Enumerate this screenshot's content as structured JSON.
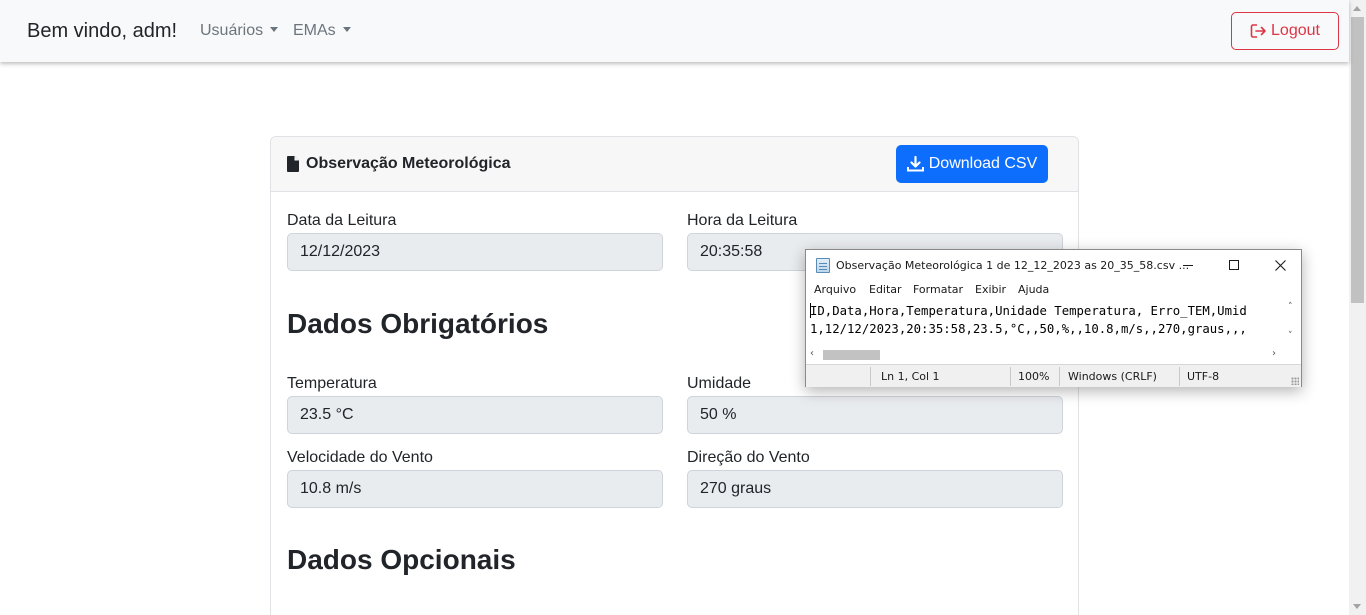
{
  "navbar": {
    "brand": "Bem vindo, adm!",
    "menu_users": "Usuários",
    "menu_emas": "EMAs",
    "logout_label": "Logout",
    "logout_color": "#dc3545"
  },
  "card": {
    "title": "Observação Meteorológica",
    "download_label": "Download CSV",
    "download_color": "#0d6efd",
    "fields": {
      "data_label": "Data da Leitura",
      "data_value": "12/12/2023",
      "hora_label": "Hora da Leitura",
      "hora_value": "20:35:58",
      "temp_label": "Temperatura",
      "temp_value": "23.5 °C",
      "umid_label": "Umidade",
      "umid_value": "50 %",
      "vel_label": "Velocidade do Vento",
      "vel_value": "10.8 m/s",
      "dir_label": "Direção do Vento",
      "dir_value": "270 graus"
    },
    "section_required": "Dados Obrigatórios",
    "section_optional": "Dados Opcionais"
  },
  "notepad": {
    "title": "Observação Meteorológica 1 de 12_12_2023 as 20_35_58.csv ...",
    "menus": [
      "Arquivo",
      "Editar",
      "Formatar",
      "Exibir",
      "Ajuda"
    ],
    "lines": [
      "ID,Data,Hora,Temperatura,Unidade Temperatura, Erro_TEM,Umid",
      "1,12/12/2023,20:35:58,23.5,°C,,50,%,,10.8,m/s,,270,graus,,,"
    ],
    "status": {
      "position": "Ln 1, Col 1",
      "zoom": "100%",
      "line_ending": "Windows (CRLF)",
      "encoding": "UTF-8"
    }
  }
}
